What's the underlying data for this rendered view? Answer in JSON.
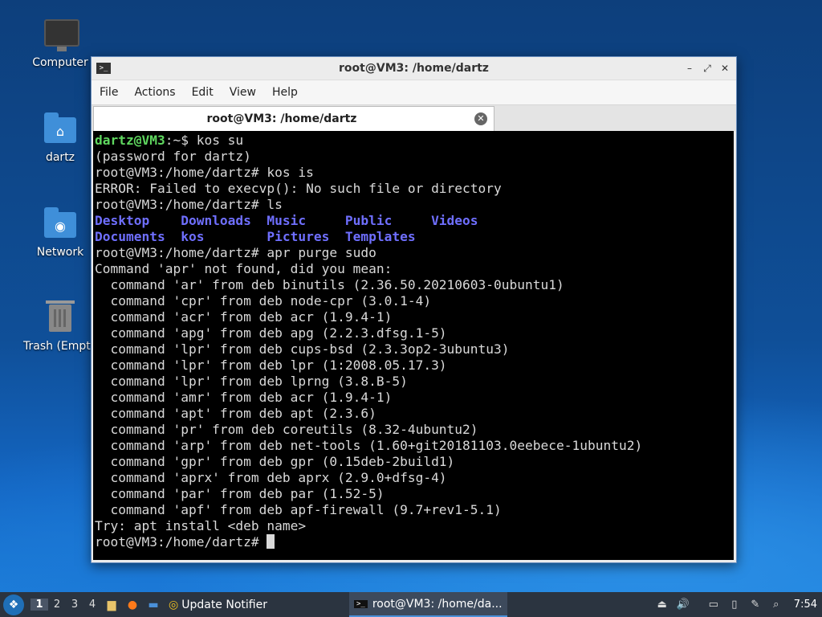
{
  "desktop": {
    "icons": [
      {
        "label": "Computer"
      },
      {
        "label": "dartz"
      },
      {
        "label": "Network"
      },
      {
        "label": "Trash (Empty)"
      }
    ]
  },
  "window": {
    "title": "root@VM3: /home/dartz",
    "menu": [
      "File",
      "Actions",
      "Edit",
      "View",
      "Help"
    ],
    "tab_label": "root@VM3: /home/dartz"
  },
  "terminal": {
    "lines": [
      {
        "parts": [
          {
            "t": "dartz@VM3",
            "c": "green"
          },
          {
            "t": ":~$ kos su",
            "c": ""
          }
        ]
      },
      {
        "parts": [
          {
            "t": "(password for dartz)",
            "c": ""
          }
        ]
      },
      {
        "parts": [
          {
            "t": "root@VM3:/home/dartz# kos is",
            "c": ""
          }
        ]
      },
      {
        "parts": [
          {
            "t": "ERROR: Failed to execvp(): No such file or directory",
            "c": ""
          }
        ]
      },
      {
        "parts": [
          {
            "t": "root@VM3:/home/dartz# ls",
            "c": ""
          }
        ]
      },
      {
        "parts": [
          {
            "t": "Desktop    Downloads  Music     Public     Videos",
            "c": "blue"
          }
        ]
      },
      {
        "parts": [
          {
            "t": "Documents  kos        Pictures  Templates",
            "c": "blue"
          }
        ]
      },
      {
        "parts": [
          {
            "t": "root@VM3:/home/dartz# apr purge sudo",
            "c": ""
          }
        ]
      },
      {
        "parts": [
          {
            "t": "Command 'apr' not found, did you mean:",
            "c": ""
          }
        ]
      },
      {
        "parts": [
          {
            "t": "  command 'ar' from deb binutils (2.36.50.20210603-0ubuntu1)",
            "c": ""
          }
        ]
      },
      {
        "parts": [
          {
            "t": "  command 'cpr' from deb node-cpr (3.0.1-4)",
            "c": ""
          }
        ]
      },
      {
        "parts": [
          {
            "t": "  command 'acr' from deb acr (1.9.4-1)",
            "c": ""
          }
        ]
      },
      {
        "parts": [
          {
            "t": "  command 'apg' from deb apg (2.2.3.dfsg.1-5)",
            "c": ""
          }
        ]
      },
      {
        "parts": [
          {
            "t": "  command 'lpr' from deb cups-bsd (2.3.3op2-3ubuntu3)",
            "c": ""
          }
        ]
      },
      {
        "parts": [
          {
            "t": "  command 'lpr' from deb lpr (1:2008.05.17.3)",
            "c": ""
          }
        ]
      },
      {
        "parts": [
          {
            "t": "  command 'lpr' from deb lprng (3.8.B-5)",
            "c": ""
          }
        ]
      },
      {
        "parts": [
          {
            "t": "  command 'amr' from deb acr (1.9.4-1)",
            "c": ""
          }
        ]
      },
      {
        "parts": [
          {
            "t": "  command 'apt' from deb apt (2.3.6)",
            "c": ""
          }
        ]
      },
      {
        "parts": [
          {
            "t": "  command 'pr' from deb coreutils (8.32-4ubuntu2)",
            "c": ""
          }
        ]
      },
      {
        "parts": [
          {
            "t": "  command 'arp' from deb net-tools (1.60+git20181103.0eebece-1ubuntu2)",
            "c": ""
          }
        ]
      },
      {
        "parts": [
          {
            "t": "  command 'gpr' from deb gpr (0.15deb-2build1)",
            "c": ""
          }
        ]
      },
      {
        "parts": [
          {
            "t": "  command 'aprx' from deb aprx (2.9.0+dfsg-4)",
            "c": ""
          }
        ]
      },
      {
        "parts": [
          {
            "t": "  command 'par' from deb par (1.52-5)",
            "c": ""
          }
        ]
      },
      {
        "parts": [
          {
            "t": "  command 'apf' from deb apf-firewall (9.7+rev1-5.1)",
            "c": ""
          }
        ]
      },
      {
        "parts": [
          {
            "t": "Try: apt install <deb name>",
            "c": ""
          }
        ]
      },
      {
        "parts": [
          {
            "t": "root@VM3:/home/dartz# ",
            "c": ""
          }
        ],
        "cursor": true
      }
    ]
  },
  "taskbar": {
    "workspaces": [
      "1",
      "2",
      "3",
      "4"
    ],
    "tasks": [
      {
        "label": "Update Notifier",
        "active": false
      },
      {
        "label": "root@VM3: /home/da...",
        "active": true
      }
    ],
    "clock": "7:54"
  },
  "colors": {
    "prompt_user": "#5fd75f",
    "directory": "#6f6fff",
    "terminal_bg": "#000000"
  }
}
